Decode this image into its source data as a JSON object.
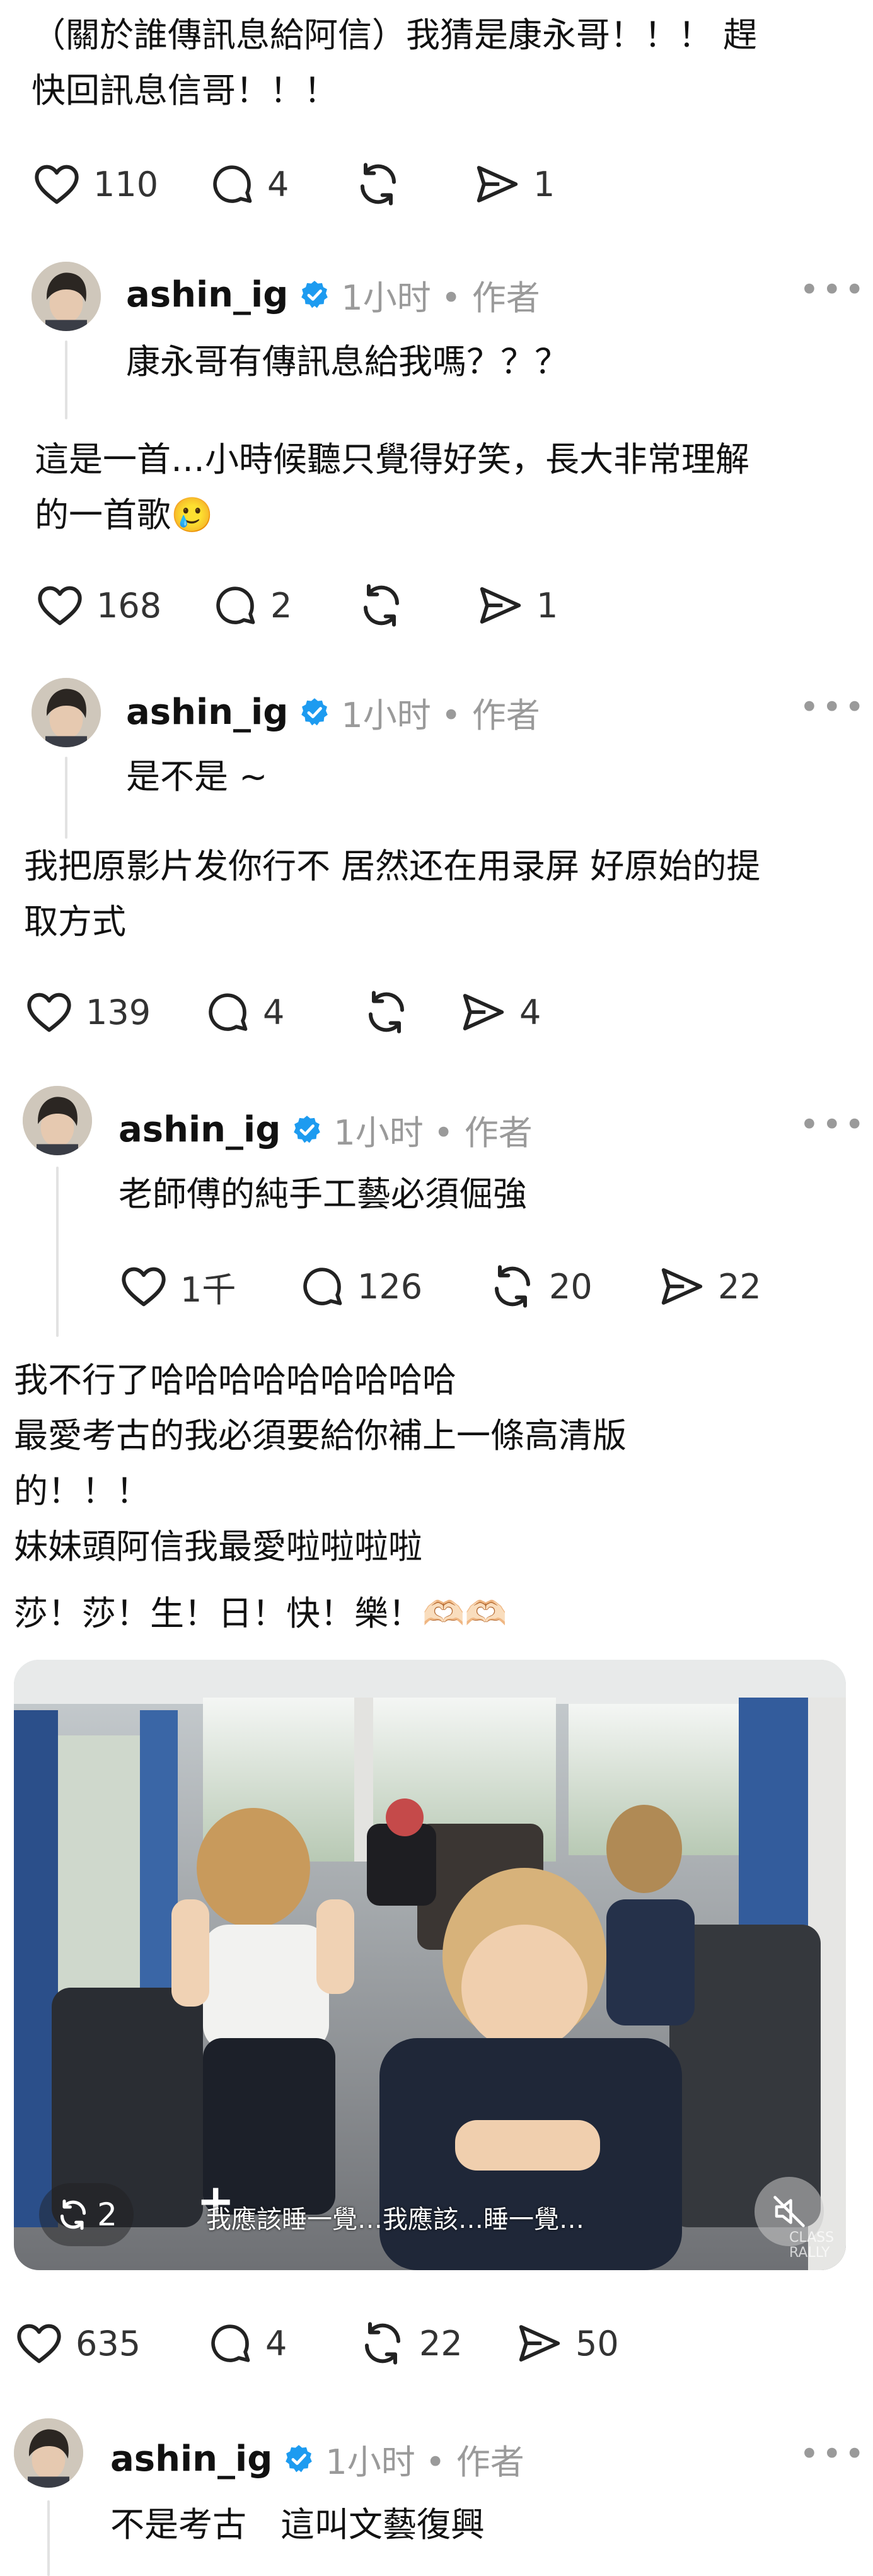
{
  "posts": [
    {
      "text": "（關於誰傳訊息給阿信）我猜是康永哥！！！ 趕\n快回訊息信哥！！！",
      "likes": "110",
      "comments": "4",
      "reposts": "",
      "shares": "1"
    },
    {
      "author": "ashin_ig",
      "time": "1小时",
      "author_tag": "• 作者",
      "reply": "康永哥有傳訊息給我嗎？？？"
    },
    {
      "text": "這是一首…小時候聽只覺得好笑，長大非常理解\n的一首歌",
      "emoji": "🥲",
      "likes": "168",
      "comments": "2",
      "reposts": "",
      "shares": "1"
    },
    {
      "author": "ashin_ig",
      "time": "1小时",
      "author_tag": "• 作者",
      "reply": "是不是 ~"
    },
    {
      "text": "我把原影片发你行不 居然还在用录屏 好原始的提\n取方式",
      "likes": "139",
      "comments": "4",
      "reposts": "",
      "shares": "4"
    },
    {
      "author": "ashin_ig",
      "time": "1小时",
      "author_tag": "• 作者",
      "reply": "老師傅的純手工藝必須倔強",
      "likes": "1千",
      "comments": "126",
      "reposts": "20",
      "shares": "22"
    },
    {
      "text": "我不行了哈哈哈哈哈哈哈哈哈\n最愛考古的我必須要給你補上一條高清版\n的！！！\n妹妹頭阿信我最愛啦啦啦啦",
      "text2": "莎！莎！生！日！快！樂！🫶🏻🫶🏻",
      "video": {
        "repost_count": "2",
        "plus": "+",
        "subtitle": "我應該睡一覺…我應該…睡一覺…",
        "watermark": "CLASS\nRALLY"
      },
      "likes": "635",
      "comments": "4",
      "reposts": "22",
      "shares": "50"
    },
    {
      "author": "ashin_ig",
      "time": "1小时",
      "author_tag": "• 作者",
      "reply": "不是考古　這叫文藝復興"
    }
  ],
  "colors": {
    "verified": "#1d9bf0",
    "meta": "#9a9a9a"
  },
  "icons": [
    "heart-icon",
    "comment-icon",
    "repost-icon",
    "share-icon",
    "verified-icon",
    "more-icon",
    "mute-icon"
  ]
}
